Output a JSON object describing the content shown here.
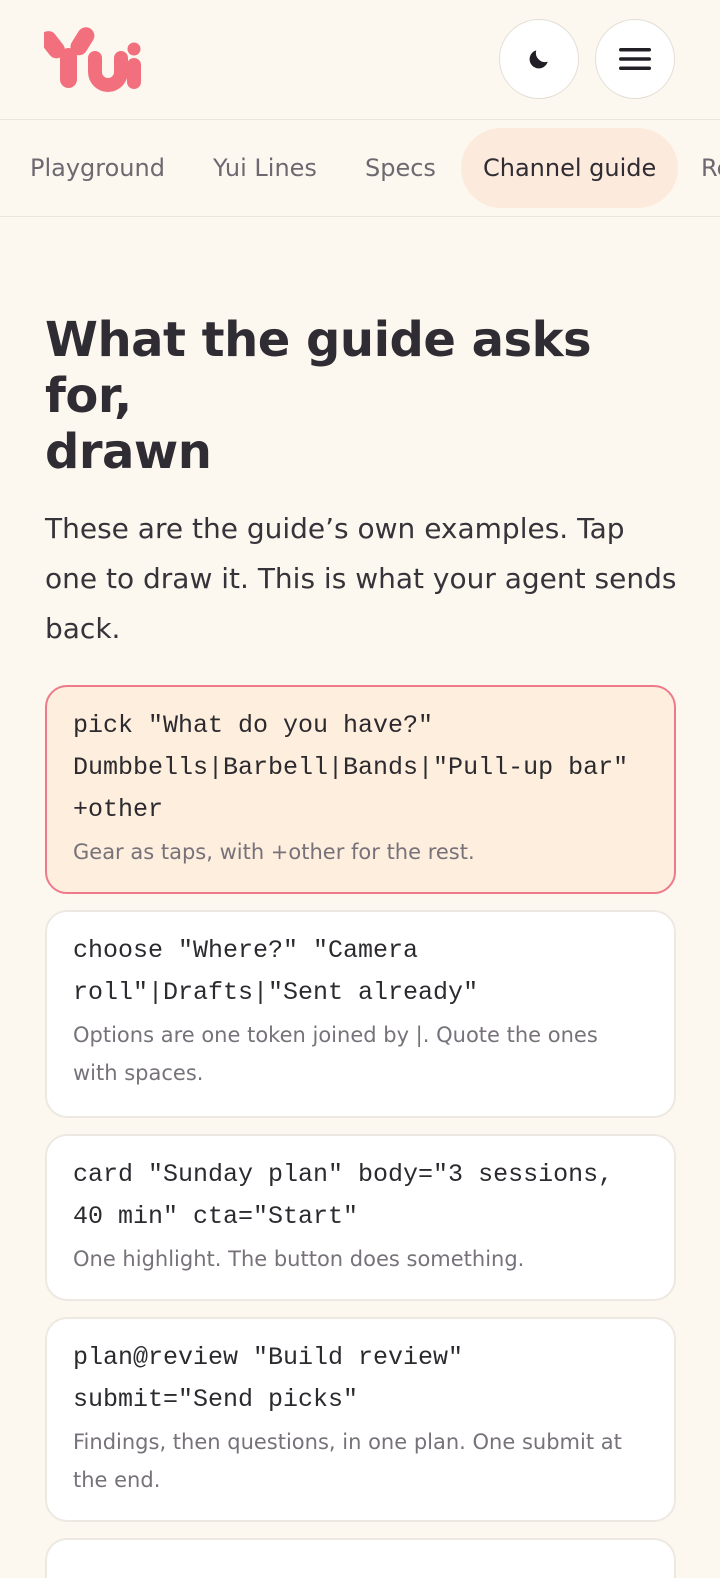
{
  "brand": {
    "logo_text": "Yui",
    "accent": "#f2707e"
  },
  "header": {
    "theme_toggle_icon": "moon-icon",
    "menu_icon": "hamburger-icon"
  },
  "tabs": [
    {
      "label": "Playground",
      "active": false
    },
    {
      "label": "Yui Lines",
      "active": false
    },
    {
      "label": "Specs",
      "active": false
    },
    {
      "label": "Channel guide",
      "active": true
    },
    {
      "label": "Re",
      "active": false
    }
  ],
  "main": {
    "title_line1": "What the guide asks for,",
    "title_line2": "drawn",
    "intro": "These are the guide’s own examples. Tap one to draw it. This is what your agent sends back."
  },
  "examples": [
    {
      "command": "pick \"What do you have?\" Dumbbells|Barbell|Bands|\"Pull-up bar\" +other",
      "description": "Gear as taps, with +other for the rest.",
      "selected": true
    },
    {
      "command": "choose \"Where?\" \"Camera roll\"|Drafts|\"Sent already\"",
      "description": "Options are one token joined by |. Quote the ones with spaces.",
      "selected": false
    },
    {
      "command": "card \"Sunday plan\" body=\"3 sessions, 40 min\" cta=\"Start\"",
      "description": "One highlight. The button does something.",
      "selected": false
    },
    {
      "command": "plan@review \"Build review\" submit=\"Send picks\"",
      "description": "Findings, then questions, in one plan. One submit at the end.",
      "selected": false
    }
  ]
}
